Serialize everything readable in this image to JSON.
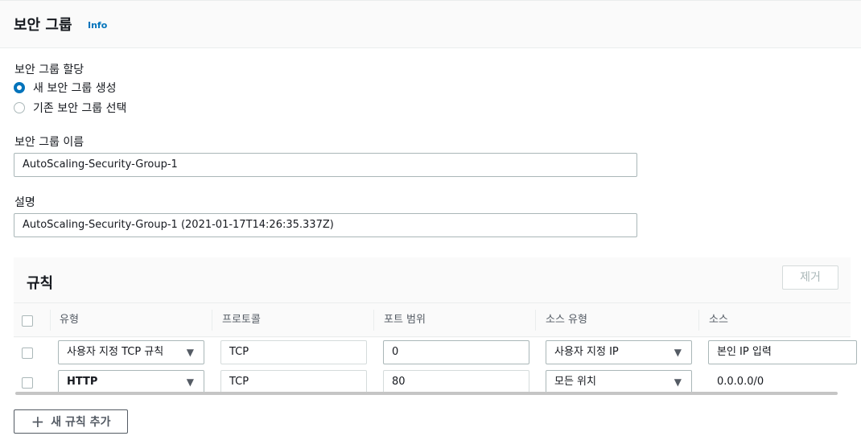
{
  "header": {
    "title": "보안 그룹",
    "info": "Info"
  },
  "assignment": {
    "label": "보안 그룹 할당",
    "options": [
      {
        "label": "새 보안 그룹 생성",
        "selected": true
      },
      {
        "label": "기존 보안 그룹 선택",
        "selected": false
      }
    ]
  },
  "name_field": {
    "label": "보안 그룹 이름",
    "value": "AutoScaling-Security-Group-1"
  },
  "description_field": {
    "label": "설명",
    "value": "AutoScaling-Security-Group-1 (2021-01-17T14:26:35.337Z)"
  },
  "rules": {
    "title": "규칙",
    "remove_label": "제거",
    "columns": [
      "유형",
      "프로토콜",
      "포트 범위",
      "소스 유형",
      "소스"
    ],
    "rows": [
      {
        "type": "사용자 지정 TCP 규칙",
        "protocol": "TCP",
        "port": "0",
        "source_type": "사용자 지정 IP",
        "source": "본인 IP 입력"
      },
      {
        "type": "HTTP",
        "protocol": "TCP",
        "port": "80",
        "source_type": "모든 위치",
        "source": "0.0.0.0/0"
      }
    ],
    "add_label": "새 규칙 추가"
  },
  "colors": {
    "accent": "#0073bb",
    "border": "#aab7b8",
    "panel_bg": "#fafafa"
  },
  "icons": {
    "dropdown": "caret-down-icon",
    "add": "plus-icon"
  }
}
